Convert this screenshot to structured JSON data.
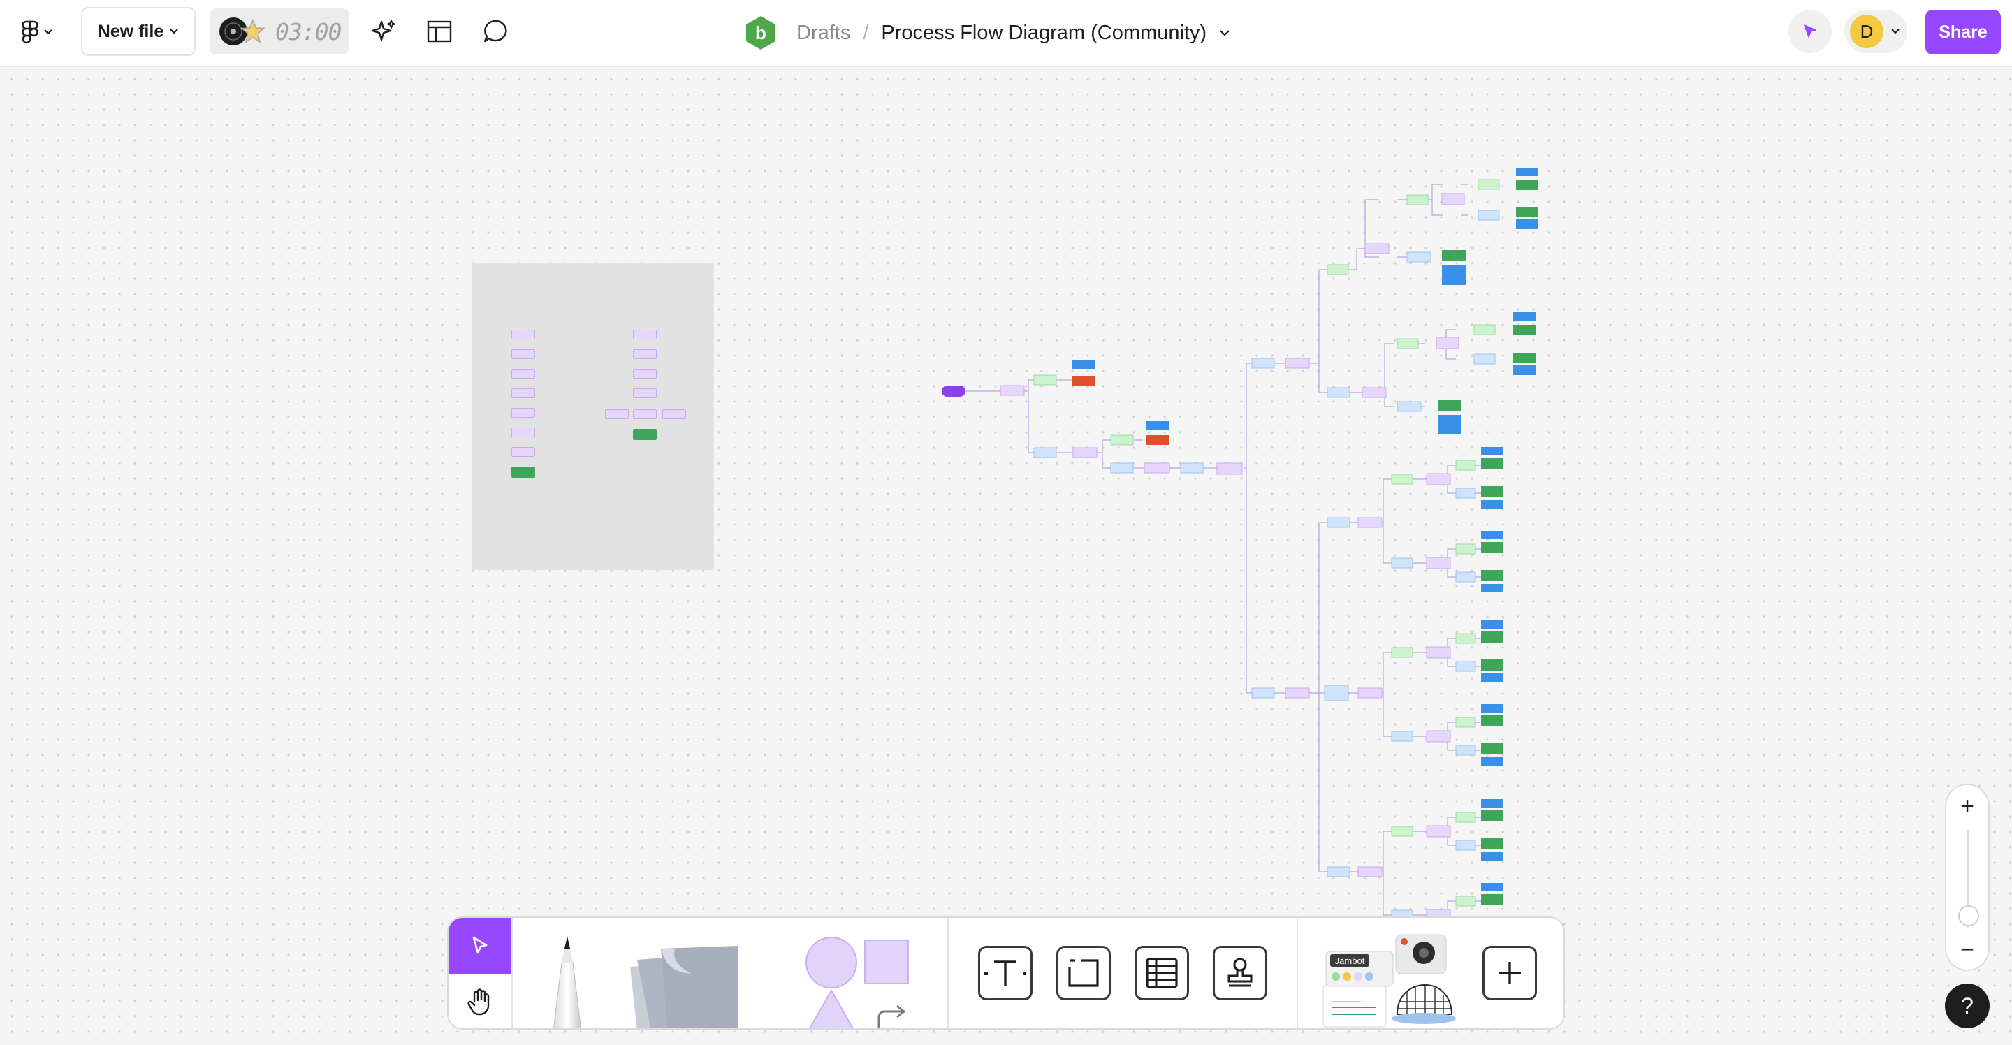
{
  "app": {
    "file_button_label": "New file",
    "timer_text": "03:00",
    "workspace_badge": "b"
  },
  "breadcrumb": {
    "drafts": "Drafts",
    "separator": "/",
    "title": "Process Flow Diagram (Community)"
  },
  "user": {
    "avatar_initial": "D",
    "share_label": "Share"
  },
  "toolbar": {
    "tools": [
      "select",
      "hand",
      "pencil",
      "sticky-note",
      "shapes",
      "connector",
      "text",
      "section",
      "table",
      "stamp",
      "widgets",
      "add"
    ],
    "widget_label": "Jambot"
  },
  "zoom": {
    "in_label": "+",
    "out_label": "–"
  },
  "help": {
    "label": "?"
  },
  "colors": {
    "accent": "#9747ff",
    "node_purple": "#e6d6fb",
    "node_green": "#cdf2cf",
    "node_blue": "#cfe3fb",
    "node_dark_green": "#3fa55b",
    "node_bright_blue": "#3a8fe8",
    "node_red": "#e0502f"
  }
}
